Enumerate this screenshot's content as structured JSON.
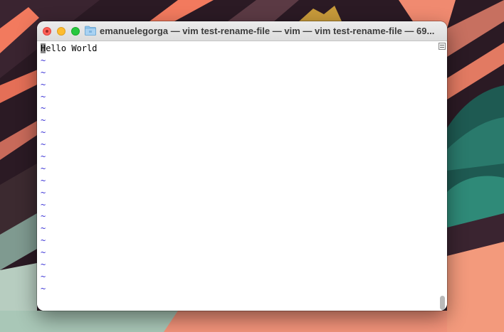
{
  "window": {
    "title": "emanuelegorga — vim test-rename-file — vim — vim test-rename-file — 69..."
  },
  "editor": {
    "first_line_cursor_char": "H",
    "first_line_rest": "ello World",
    "tilde_lines": [
      "~",
      "~",
      "~",
      "~",
      "~",
      "~",
      "~",
      "~",
      "~",
      "~",
      "~",
      "~",
      "~",
      "~",
      "~",
      "~",
      "~",
      "~",
      "~",
      "~"
    ]
  },
  "colors": {
    "tilde": "#3a32d6",
    "close": "#ff5f57",
    "minimize": "#febc2e",
    "maximize": "#28c840"
  },
  "icons": {
    "folder": "folder-icon",
    "split": "split-view-icon"
  }
}
